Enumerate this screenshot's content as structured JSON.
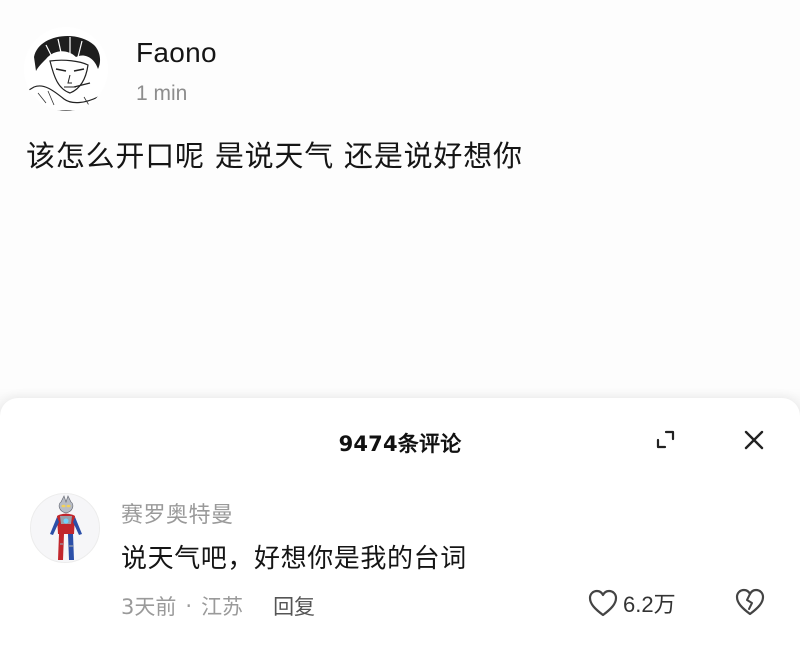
{
  "post": {
    "author": "Faono",
    "time": "1 min",
    "text": "该怎么开口呢 是说天气 还是说好想你",
    "avatar_icon": "sketch-portrait-avatar"
  },
  "comments_panel": {
    "title": "9474条评论",
    "expand_icon": "expand-icon",
    "close_icon": "close-icon"
  },
  "comment": {
    "username": "赛罗奥特曼",
    "text": "说天气吧，好想你是我的台词",
    "time": "3天前",
    "separator": "·",
    "location": "江苏",
    "reply_label": "回复",
    "like_count": "6.2万",
    "like_icon": "heart-icon",
    "dislike_icon": "broken-heart-icon",
    "avatar_icon": "ultraman-avatar"
  }
}
